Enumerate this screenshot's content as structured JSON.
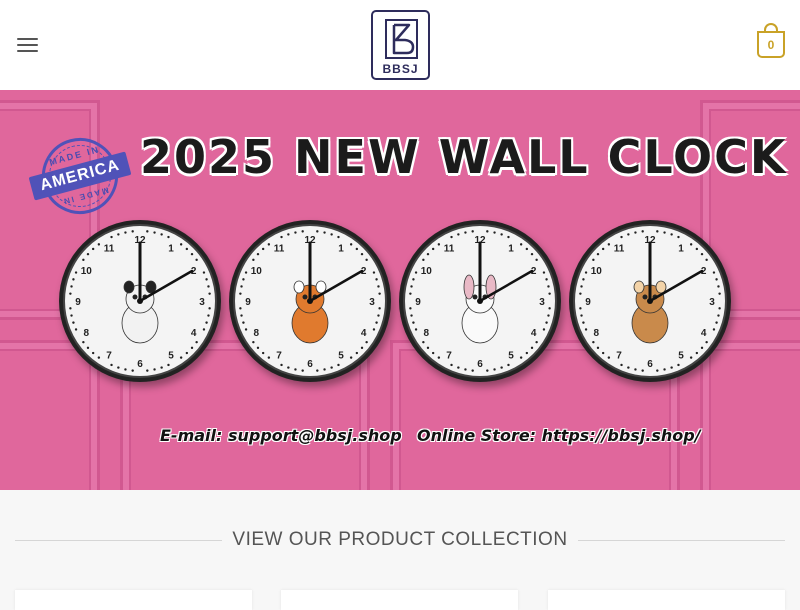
{
  "header": {
    "menu_icon": "hamburger-menu-icon",
    "logo_text": "BBSJ",
    "cart_count": "0",
    "cart_icon": "shopping-bag-icon",
    "accent_color": "#c9a227",
    "brand_color": "#2e2c5c"
  },
  "banner": {
    "title": "2025 NEW WALL CLOCK",
    "stamp_top": "MADE IN",
    "stamp_main": "AMERICA",
    "stamp_bottom": "MADE IN",
    "email": "E-mail: support@bbsj.shop",
    "store": "Online Store: https://bbsj.shop/",
    "background_color": "#e0679c",
    "clocks": [
      {
        "animal": "panda",
        "numbers": [
          "12",
          "1",
          "2",
          "3",
          "4",
          "5",
          "6",
          "7",
          "8",
          "9",
          "10",
          "11"
        ]
      },
      {
        "animal": "fox",
        "numbers": [
          "12",
          "1",
          "2",
          "3",
          "4",
          "5",
          "6",
          "7",
          "8",
          "9",
          "10",
          "11"
        ]
      },
      {
        "animal": "rabbit",
        "numbers": [
          "12",
          "1",
          "2",
          "3",
          "4",
          "5",
          "6",
          "7",
          "8",
          "9",
          "10",
          "11"
        ]
      },
      {
        "animal": "squirrel",
        "numbers": [
          "12",
          "1",
          "2",
          "3",
          "4",
          "5",
          "6",
          "7",
          "8",
          "9",
          "10",
          "11"
        ]
      }
    ]
  },
  "section": {
    "heading": "VIEW OUR PRODUCT COLLECTION"
  }
}
